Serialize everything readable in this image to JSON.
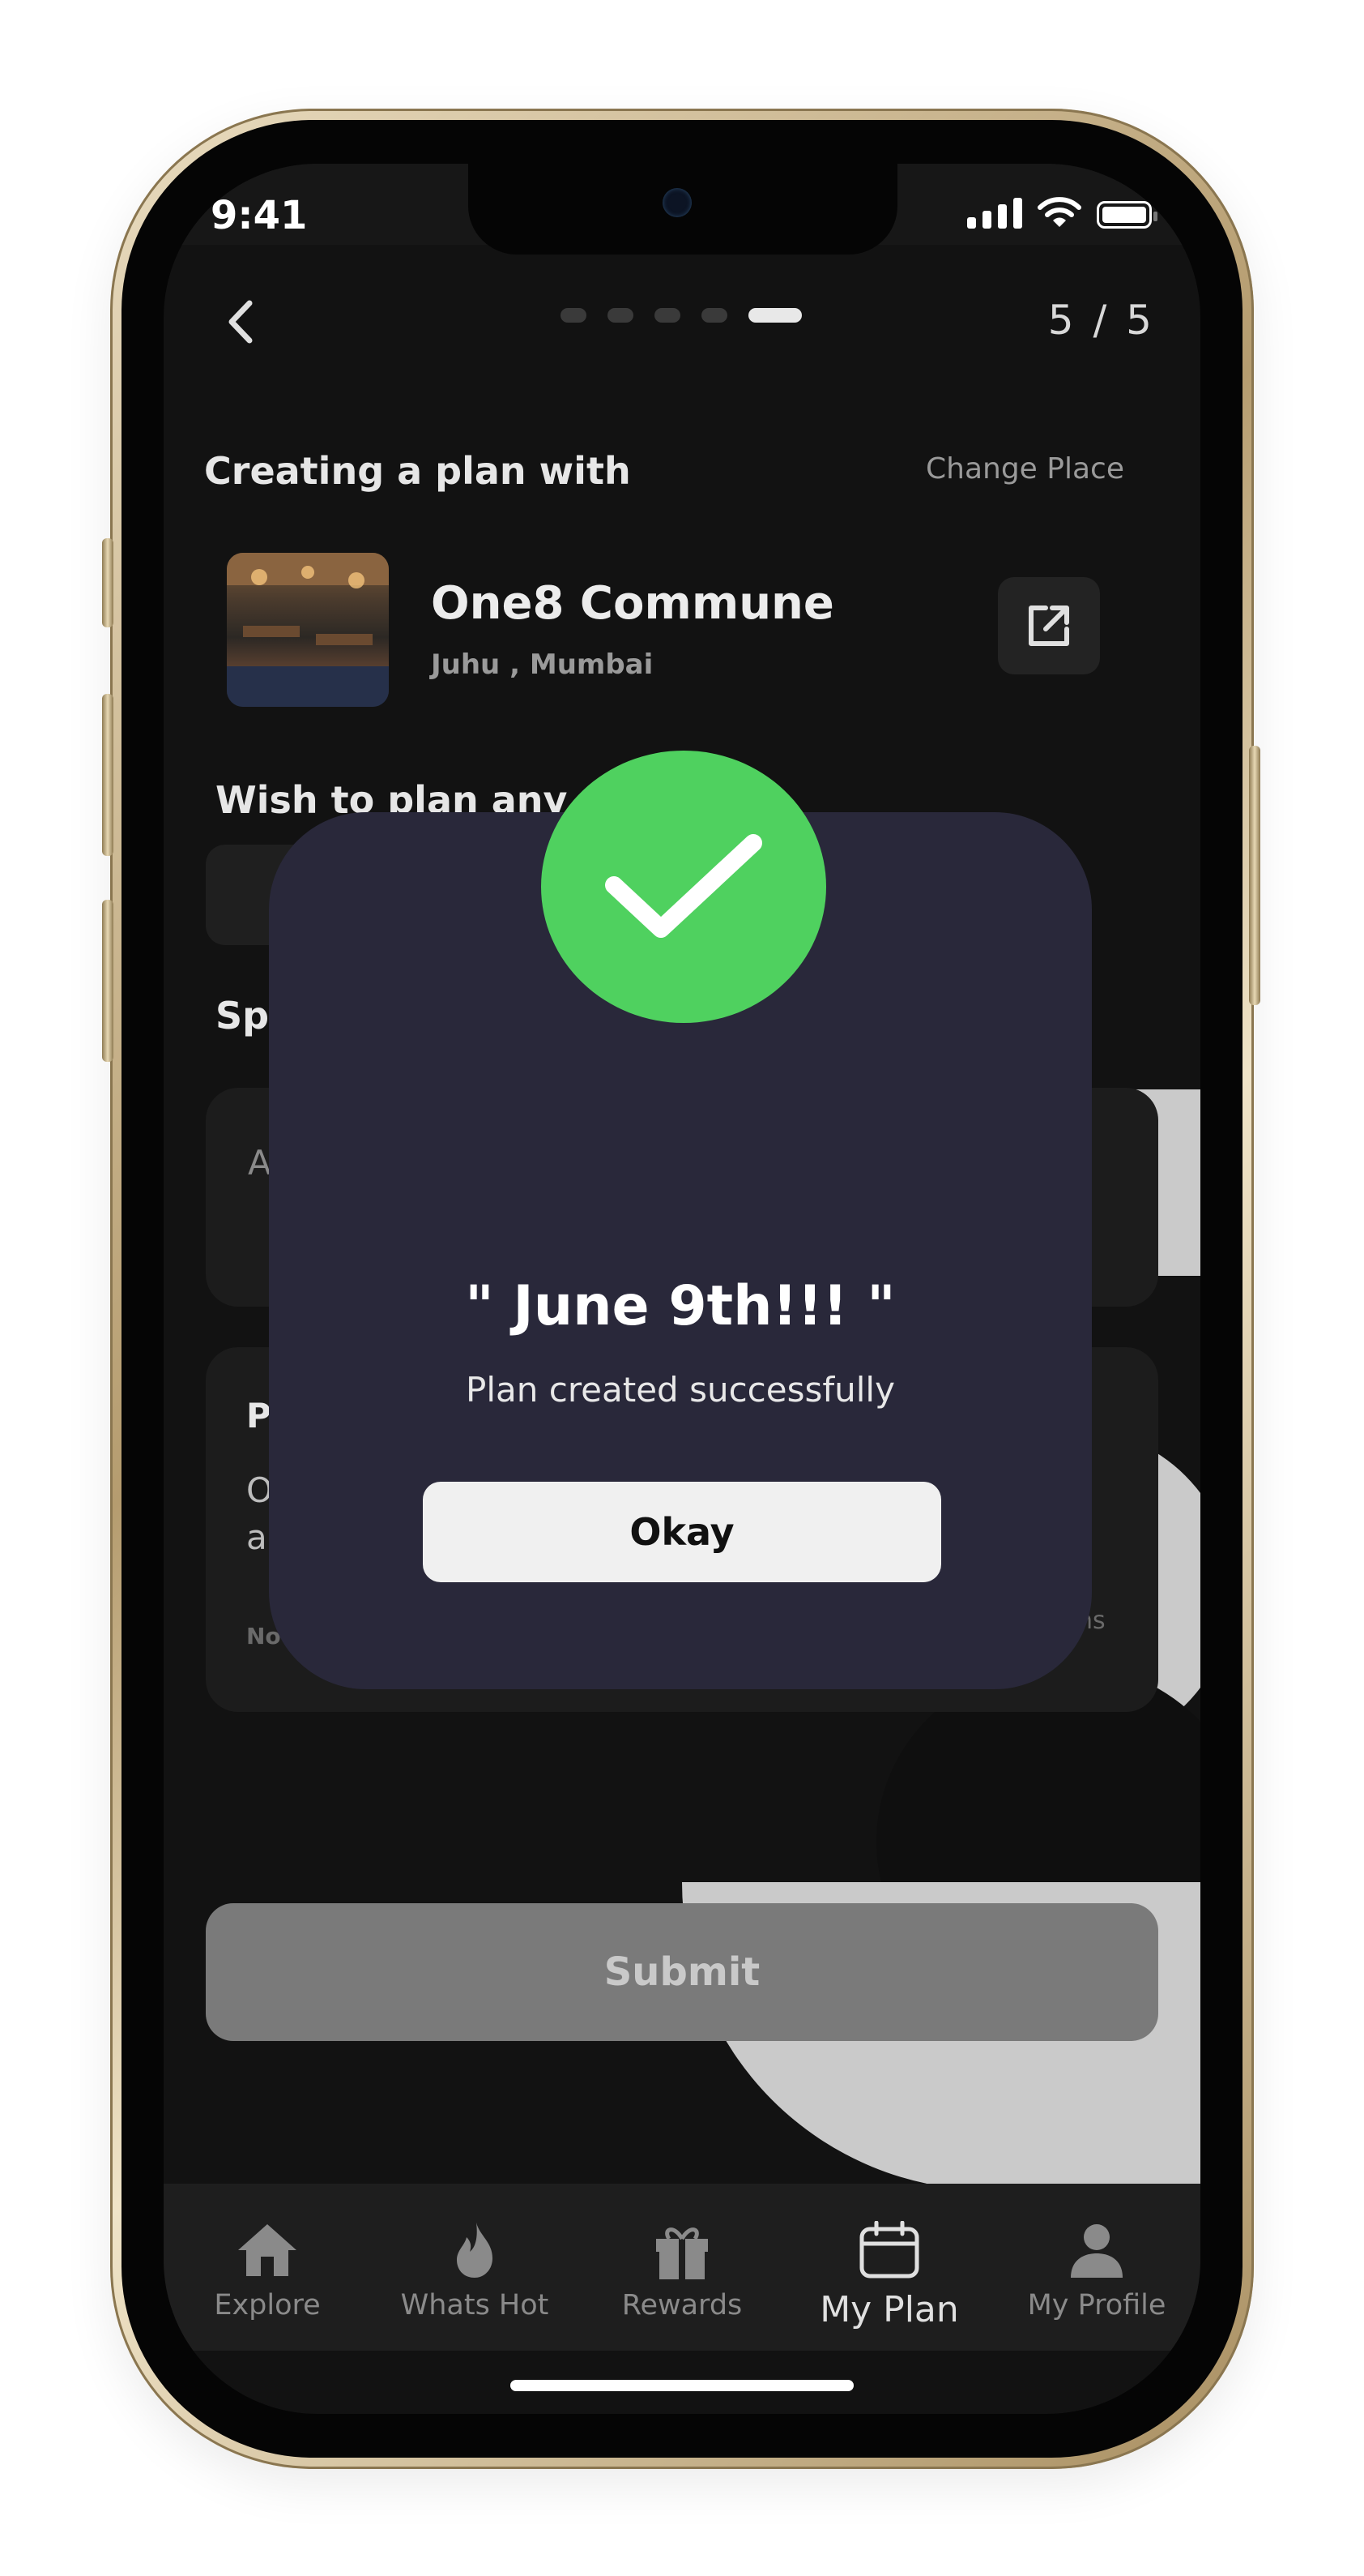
{
  "status_bar": {
    "time": "9:41"
  },
  "header": {
    "step_indicator": "5 / 5",
    "steps_total": 5,
    "steps_current": 5
  },
  "place": {
    "section_title": "Creating a plan with",
    "change_label": "Change Place",
    "name": "One8 Commune",
    "location": "Juhu , Mumbai"
  },
  "form": {
    "wish_label": "Wish to plan any s",
    "special_label": "Sp",
    "input_placeholder_partial": "A",
    "policy_title_partial": "P",
    "policy_text_line1_partial": "O",
    "policy_text_line2_partial": "a",
    "note_partial": "Not",
    "terms_partial": "ns",
    "submit_label": "Submit"
  },
  "modal": {
    "title": "\" June 9th!!! \"",
    "message": "Plan created successfully",
    "okay_label": "Okay",
    "accent_color": "#4fd15f"
  },
  "tabs": [
    {
      "label": "Explore",
      "icon": "home-icon"
    },
    {
      "label": "Whats Hot",
      "icon": "flame-icon"
    },
    {
      "label": "Rewards",
      "icon": "gift-icon"
    },
    {
      "label": "My Plan",
      "icon": "calendar-icon",
      "active": true
    },
    {
      "label": "My Profile",
      "icon": "profile-icon"
    }
  ]
}
